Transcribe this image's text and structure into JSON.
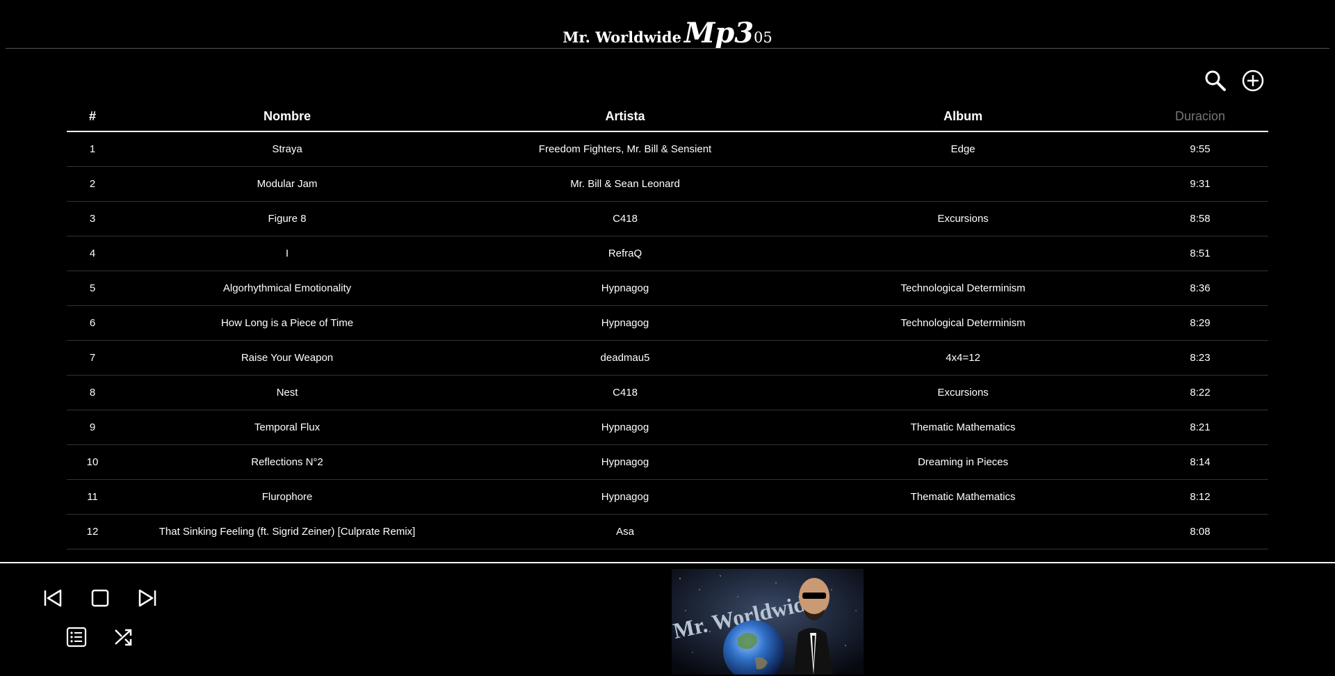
{
  "header": {
    "title_prefix": "Mr. Worldwide",
    "title_main": "Mp3",
    "title_suffix": "05"
  },
  "toolbar": {
    "search_icon": "search-icon",
    "add_icon": "plus-circle-icon"
  },
  "table": {
    "columns": [
      "#",
      "Nombre",
      "Artista",
      "Album",
      "Duracion"
    ],
    "rows": [
      {
        "num": "1",
        "name": "Straya",
        "artist": "Freedom Fighters, Mr. Bill & Sensient",
        "album": "Edge",
        "duration": "9:55"
      },
      {
        "num": "2",
        "name": "Modular Jam",
        "artist": "Mr. Bill & Sean Leonard",
        "album": "",
        "duration": "9:31"
      },
      {
        "num": "3",
        "name": "Figure 8",
        "artist": "C418",
        "album": "Excursions",
        "duration": "8:58"
      },
      {
        "num": "4",
        "name": "I",
        "artist": "RefraQ",
        "album": "",
        "duration": "8:51"
      },
      {
        "num": "5",
        "name": "Algorhythmical Emotionality",
        "artist": "Hypnagog",
        "album": "Technological Determinism",
        "duration": "8:36"
      },
      {
        "num": "6",
        "name": "How Long is a Piece of Time",
        "artist": "Hypnagog",
        "album": "Technological Determinism",
        "duration": "8:29"
      },
      {
        "num": "7",
        "name": "Raise Your Weapon",
        "artist": "deadmau5",
        "album": "4x4=12",
        "duration": "8:23"
      },
      {
        "num": "8",
        "name": "Nest",
        "artist": "C418",
        "album": "Excursions",
        "duration": "8:22"
      },
      {
        "num": "9",
        "name": "Temporal Flux",
        "artist": "Hypnagog",
        "album": "Thematic Mathematics",
        "duration": "8:21"
      },
      {
        "num": "10",
        "name": "Reflections N°2",
        "artist": "Hypnagog",
        "album": "Dreaming in Pieces",
        "duration": "8:14"
      },
      {
        "num": "11",
        "name": "Flurophore",
        "artist": "Hypnagog",
        "album": "Thematic Mathematics",
        "duration": "8:12"
      },
      {
        "num": "12",
        "name": "That Sinking Feeling (ft. Sigrid Zeiner) [Culprate Remix]",
        "artist": "Asa",
        "album": "",
        "duration": "8:08"
      }
    ]
  },
  "player": {
    "prev_icon": "skip-previous-icon",
    "stop_icon": "stop-icon",
    "next_icon": "skip-next-icon",
    "playlist_icon": "playlist-icon",
    "shuffle_icon": "shuffle-icon",
    "cover_text": "Mr. Worldwide"
  },
  "colors": {
    "background": "#000000",
    "text": "#ffffff",
    "dim_header": "#777777",
    "row_divider": "#333333"
  }
}
